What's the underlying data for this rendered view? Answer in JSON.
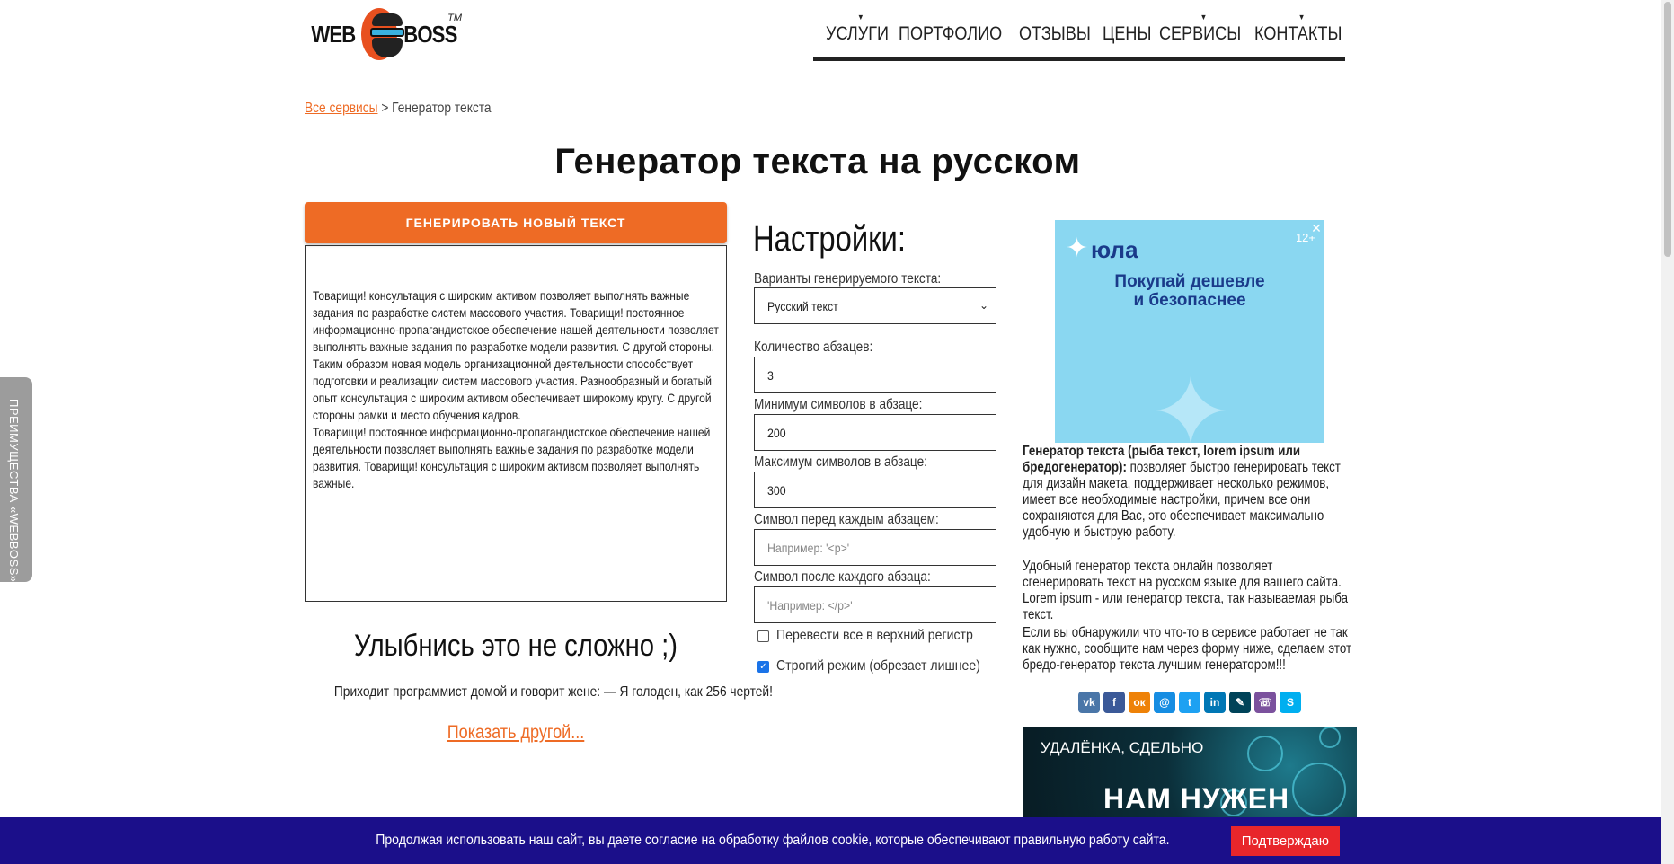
{
  "logo": {
    "left": "WEB",
    "right": "BOSS",
    "tm": "TM"
  },
  "nav": [
    {
      "label": "УСЛУГИ",
      "has_dropdown": true
    },
    {
      "label": "ПОРТФОЛИО",
      "has_dropdown": false
    },
    {
      "label": "ОТЗЫВЫ",
      "has_dropdown": false
    },
    {
      "label": "ЦЕНЫ",
      "has_dropdown": false
    },
    {
      "label": "СЕРВИСЫ",
      "has_dropdown": true
    },
    {
      "label": "КОНТАКТЫ",
      "has_dropdown": true
    }
  ],
  "breadcrumb": {
    "link": "Все сервисы",
    "sep": ">",
    "current": "Генератор текста"
  },
  "page_title": "Генератор текста на русском",
  "generator": {
    "button_label": "ГЕНЕРИРОВАТЬ НОВЫЙ ТЕКСТ",
    "output_text": "Товарищи! консультация с широким активом позволяет выполнять важные задания по разработке систем массового участия. Товарищи! постоянное информационно-пропагандистское обеспечение нашей деятельности позволяет выполнять важные задания по разработке модели развития. С другой стороны.\nТаким образом новая модель организационной деятельности способствует подготовки и реализации систем массового участия. Разнообразный и богатый опыт консультация с широким активом обеспечивает широкому кругу. С другой стороны рамки и место обучения кадров.\nТоварищи! постоянное информационно-пропагандистское обеспечение нашей деятельности позволяет выполнять важные задания по разработке модели развития. Товарищи! консультация с широким активом позволяет выполнять важные."
  },
  "joke": {
    "title": "Улыбнись это не сложно ;)",
    "text": "Приходит программист домой и говорит жене: — Я голоден, как 256 чертей!",
    "show_other": "Показать другой..."
  },
  "settings": {
    "title": "Настройки:",
    "variant_label": "Варианты генерируемого текста:",
    "variant_value": "Русский текст",
    "paragraphs_label": "Количество абзацев:",
    "paragraphs_value": "3",
    "min_label": "Минимум символов в абзаце:",
    "min_value": "200",
    "max_label": "Максимум символов в абзаце:",
    "max_value": "300",
    "before_label": "Символ перед каждым абзацем:",
    "before_placeholder": "Например: '<p>'",
    "after_label": "Символ после каждого абзаца:",
    "after_placeholder": "'Например: </p>'",
    "uppercase_label": "Перевести все в верхний регистр",
    "uppercase_checked": false,
    "strict_label": "Строгий режим (обрезает лишнее)",
    "strict_checked": true
  },
  "ad1": {
    "brand": "юла",
    "age": "12+",
    "slogan_line1": "Покупай дешевле",
    "slogan_line2": "и безопаснее",
    "close": "✕"
  },
  "description": {
    "p1_bold": "Генератор текста (рыба текст, lorem ipsum или бредогенератор):",
    "p1_rest": " позволяет быстро генерировать текст для дизайн макета, поддерживает несколько режимов, имеет все необходимые настройки, причем все они сохраняются для Вас, это обеспечивает максимально удобную и быструю работу.",
    "p2": "Удобный генератор текста онлайн позволяет сгенерировать текст на русском языке для вашего сайта. Lorem ipsum - или генератор текста, так называемая рыба текст.",
    "p3": "Если вы обнаружили что что-то в сервисе работает не так как нужно, сообщите нам через форму ниже, сделаем этот бредо-генератор текста лучшим генератором!!!"
  },
  "share": [
    {
      "name": "vk-icon",
      "glyph": "vk",
      "color": "#4a76a8"
    },
    {
      "name": "facebook-icon",
      "glyph": "f",
      "color": "#3b5998"
    },
    {
      "name": "odnoklassniki-icon",
      "glyph": "ок",
      "color": "#ee8208"
    },
    {
      "name": "mailru-icon",
      "glyph": "@",
      "color": "#168de2"
    },
    {
      "name": "twitter-icon",
      "glyph": "t",
      "color": "#1da1f2"
    },
    {
      "name": "linkedin-icon",
      "glyph": "in",
      "color": "#0077b5"
    },
    {
      "name": "livejournal-icon",
      "glyph": "✎",
      "color": "#004359"
    },
    {
      "name": "viber-icon",
      "glyph": "☏",
      "color": "#7b519d"
    },
    {
      "name": "skype-icon",
      "glyph": "S",
      "color": "#00aff0"
    }
  ],
  "ad2": {
    "line1": "УДАЛЁНКА, СДЕЛЬНО",
    "line2": "НАМ НУЖЕН"
  },
  "side_tab": "ПРЕИМУЩЕСТВА «WEBBOSS»",
  "cookie": {
    "text": "Продолжая использовать наш сайт, вы даете согласие на обработку файлов cookie, которые обеспечивают правильную работу сайта.",
    "button": "Подтверждаю"
  },
  "colors": {
    "accent": "#ee6b25",
    "cookie_bg": "#1b0f8a",
    "cookie_btn": "#e8262b",
    "ad_bg": "#8ad7f1"
  }
}
